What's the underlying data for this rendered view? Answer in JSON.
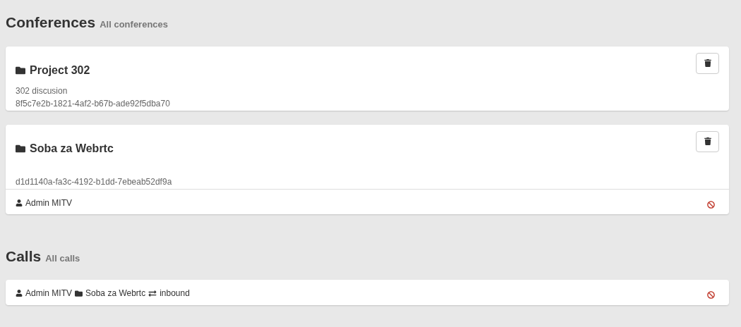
{
  "conferences": {
    "title": "Conferences",
    "subtitle": "All conferences",
    "items": [
      {
        "name": "Project 302",
        "description": "302 discusion",
        "id": "8f5c7e2b-1821-4af2-b67b-ade92f5dba70"
      },
      {
        "name": "Soba za Webrtc",
        "id": "d1d1140a-fa3c-4192-b1dd-7ebeab52df9a",
        "members": [
          {
            "name": "Admin MITV"
          }
        ]
      }
    ]
  },
  "calls": {
    "title": "Calls",
    "subtitle": "All calls",
    "items": [
      {
        "user": "Admin MITV",
        "conference": "Soba za Webrtc",
        "direction": "inbound"
      }
    ]
  }
}
